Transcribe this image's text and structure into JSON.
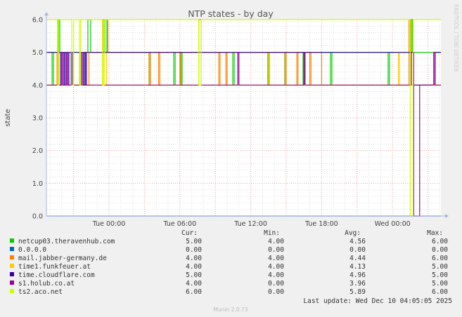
{
  "chart_data": {
    "type": "line",
    "title": "NTP states - by day",
    "ylabel": "state",
    "xlabel": "",
    "ylim": [
      0,
      6
    ],
    "xlim_hours_from_tue_0000": [
      -5.3,
      28.1
    ],
    "y_ticks": [
      "0.0",
      "1.0",
      "2.0",
      "3.0",
      "4.0",
      "5.0",
      "6.0"
    ],
    "x_ticks": [
      {
        "label": "Tue 00:00",
        "hour": 0
      },
      {
        "label": "Tue 06:00",
        "hour": 6
      },
      {
        "label": "Tue 12:00",
        "hour": 12
      },
      {
        "label": "Tue 18:00",
        "hour": 18
      },
      {
        "label": "Wed 00:00",
        "hour": 24
      }
    ],
    "grid": true,
    "watermark": "RRDTOOL / TOBI OETIKER",
    "legend_headers": {
      "cur": "Cur:",
      "min": "Min:",
      "avg": "Avg:",
      "max": "Max:"
    },
    "series": [
      {
        "name": "netcup03.theravenhub.com",
        "color": "#00cc00",
        "cur": "5.00",
        "min": "4.00",
        "avg": "4.56",
        "max": "6.00",
        "steps": [
          [
            -5.3,
            5
          ],
          [
            -4.82,
            4
          ],
          [
            -4.7,
            5
          ],
          [
            -4.29,
            6
          ],
          [
            -4.17,
            5
          ],
          [
            -1.79,
            6
          ],
          [
            -1.55,
            5
          ],
          [
            -0.36,
            6
          ],
          [
            -0.18,
            5
          ],
          [
            3.39,
            4
          ],
          [
            3.51,
            5
          ],
          [
            5.48,
            4
          ],
          [
            5.6,
            5
          ],
          [
            6.07,
            4
          ],
          [
            6.19,
            5
          ],
          [
            10.48,
            4
          ],
          [
            10.6,
            5
          ],
          [
            13.45,
            4
          ],
          [
            13.57,
            5
          ],
          [
            14.88,
            4
          ],
          [
            15.0,
            5
          ],
          [
            16.43,
            4
          ],
          [
            16.55,
            5
          ],
          [
            18.75,
            4
          ],
          [
            18.87,
            5
          ],
          [
            23.63,
            4
          ],
          [
            23.75,
            5
          ],
          [
            25.54,
            6
          ],
          [
            25.7,
            5
          ],
          [
            27.5,
            4
          ],
          [
            27.62,
            5
          ]
        ]
      },
      {
        "name": "0.0.0.0",
        "color": "#0066b3",
        "cur": "0.00",
        "min": "0.00",
        "avg": "0.00",
        "max": "0.00",
        "steps": [
          [
            -5.3,
            0
          ]
        ]
      },
      {
        "name": "mail.jabber-germany.de",
        "color": "#ff8000",
        "cur": "4.00",
        "min": "4.00",
        "avg": "4.44",
        "max": "6.00",
        "steps": [
          [
            -5.3,
            4
          ],
          [
            -4.4,
            5
          ],
          [
            -4.3,
            4
          ],
          [
            -1.7,
            5
          ],
          [
            -0.5,
            6
          ],
          [
            -0.1,
            5
          ],
          [
            3.4,
            4
          ],
          [
            3.5,
            5
          ],
          [
            4.2,
            4
          ],
          [
            4.3,
            5
          ],
          [
            6.0,
            4
          ],
          [
            6.1,
            5
          ],
          [
            7.6,
            6
          ],
          [
            7.8,
            5
          ],
          [
            9.3,
            4
          ],
          [
            9.4,
            5
          ],
          [
            9.9,
            4
          ],
          [
            10.0,
            5
          ],
          [
            14.9,
            4
          ],
          [
            15.0,
            5
          ],
          [
            15.9,
            4
          ],
          [
            16.0,
            5
          ],
          [
            17.0,
            4
          ],
          [
            17.1,
            5
          ],
          [
            18.0,
            4
          ],
          [
            18.1,
            4
          ],
          [
            23.6,
            4
          ],
          [
            25.4,
            6
          ],
          [
            25.6,
            4
          ]
        ]
      },
      {
        "name": "time1.funkfeuer.at",
        "color": "#ffcc00",
        "cur": "4.00",
        "min": "4.00",
        "avg": "4.13",
        "max": "5.00",
        "steps": [
          [
            -5.3,
            4
          ],
          [
            -3.2,
            5
          ],
          [
            -3.0,
            4
          ],
          [
            -0.5,
            5
          ],
          [
            -0.2,
            4
          ],
          [
            7.6,
            5
          ],
          [
            7.8,
            4
          ],
          [
            13.5,
            5
          ],
          [
            13.6,
            4
          ],
          [
            24.5,
            5
          ],
          [
            24.6,
            4
          ]
        ]
      },
      {
        "name": "time.cloudflare.com",
        "color": "#330099",
        "cur": "5.00",
        "min": "4.00",
        "avg": "4.96",
        "max": "5.00",
        "steps": [
          [
            -5.3,
            5
          ],
          [
            -4.1,
            4
          ],
          [
            -4.0,
            5
          ],
          [
            -3.8,
            4
          ],
          [
            -3.7,
            5
          ],
          [
            -3.5,
            4
          ],
          [
            -3.4,
            5
          ],
          [
            -3.2,
            4
          ],
          [
            -3.1,
            5
          ],
          [
            -2.5,
            4
          ],
          [
            -2.4,
            5
          ],
          [
            -2.2,
            4
          ],
          [
            -2.1,
            5
          ],
          [
            -2.0,
            4
          ],
          [
            -1.9,
            5
          ],
          [
            25.8,
            4
          ],
          [
            27.5,
            5
          ]
        ]
      },
      {
        "name": "s1.holub.co.at",
        "color": "#990099",
        "cur": "4.00",
        "min": "0.00",
        "avg": "3.96",
        "max": "5.00",
        "steps": [
          [
            -5.3,
            4
          ],
          [
            -4.0,
            5
          ],
          [
            -3.9,
            4
          ],
          [
            -3.6,
            5
          ],
          [
            -3.5,
            4
          ],
          [
            -2.3,
            5
          ],
          [
            -2.2,
            4
          ],
          [
            10.9,
            5
          ],
          [
            11.0,
            4
          ],
          [
            16.5,
            5
          ],
          [
            16.6,
            4
          ],
          [
            25.6,
            5
          ],
          [
            25.8,
            0
          ],
          [
            26.3,
            4
          ],
          [
            27.5,
            5
          ],
          [
            27.6,
            4
          ]
        ]
      },
      {
        "name": "ts2.aco.net",
        "color": "#ccff00",
        "cur": "6.00",
        "min": "0.00",
        "avg": "5.89",
        "max": "6.00",
        "steps": [
          [
            -5.3,
            6
          ],
          [
            -4.35,
            4
          ],
          [
            -4.25,
            6
          ],
          [
            -3.15,
            4
          ],
          [
            -3.0,
            6
          ],
          [
            -2.5,
            4
          ],
          [
            -2.4,
            6
          ],
          [
            -0.55,
            4
          ],
          [
            -0.4,
            6
          ],
          [
            7.6,
            4
          ],
          [
            7.8,
            6
          ],
          [
            25.5,
            0
          ],
          [
            25.75,
            6
          ]
        ]
      }
    ],
    "last_update": "Last update: Wed Dec 10 04:05:05 2025",
    "footer": "Munin 2.0.73"
  }
}
